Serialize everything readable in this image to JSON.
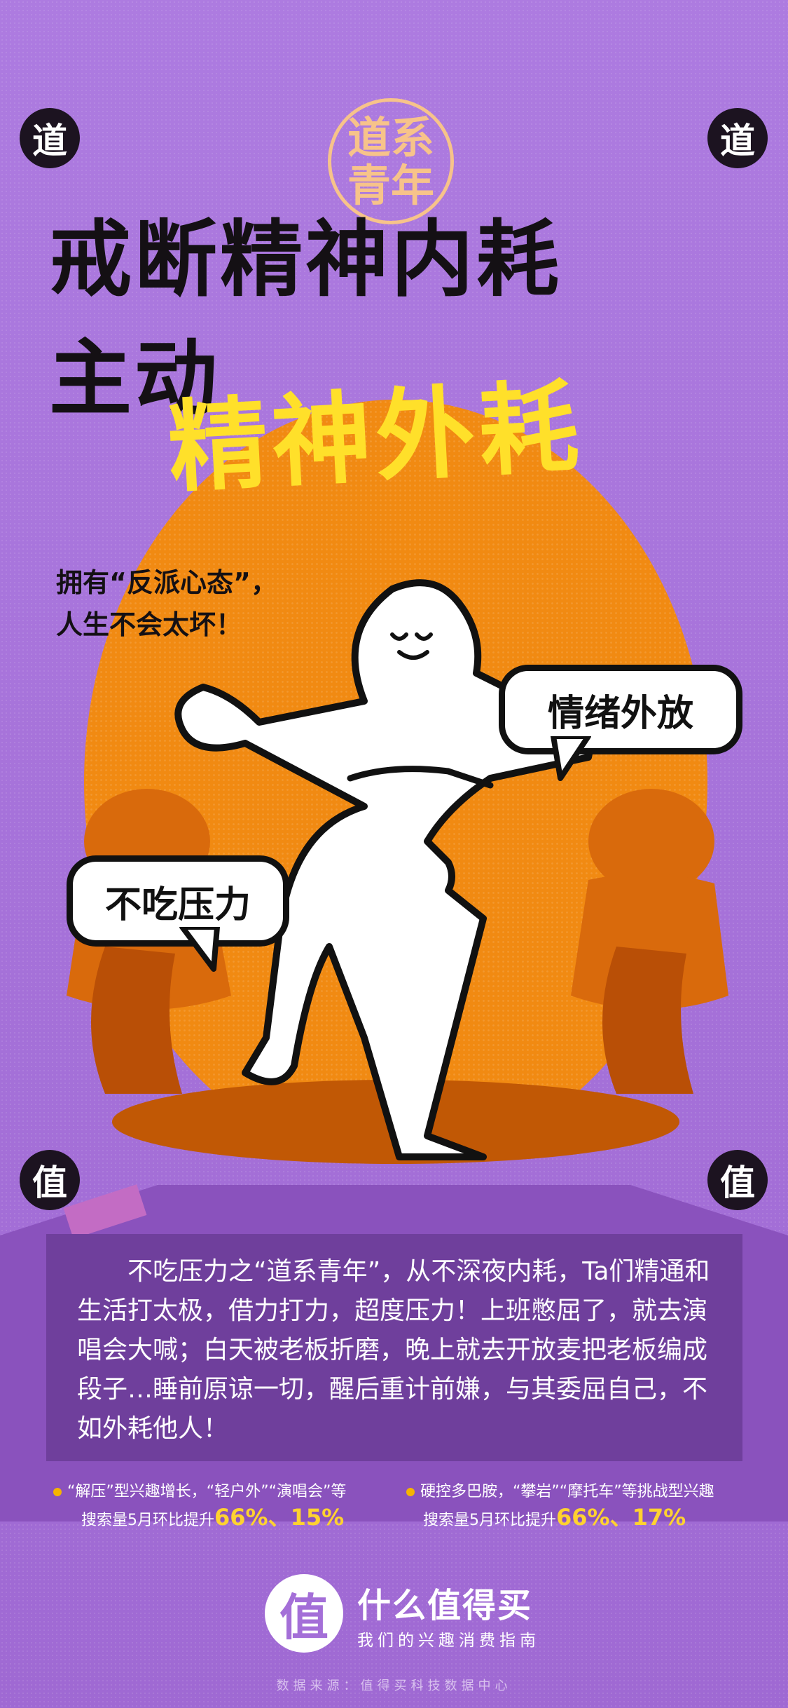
{
  "corners": {
    "top_left": "道",
    "top_right": "道",
    "bottom_left": "值",
    "bottom_right": "值"
  },
  "stamp": {
    "line1": "道系",
    "line2": "青年"
  },
  "title": {
    "line1": "戒断精神内耗",
    "line2": "主动",
    "highlight": "精神外耗"
  },
  "subtitle": {
    "line1": "拥有“反派心态”，",
    "line2": "人生不会太坏！"
  },
  "bubbles": {
    "right": "情绪外放",
    "left": "不吃压力"
  },
  "body_text": "不吃压力之“道系青年”，从不深夜内耗，Ta们精通和生活打太极，借力打力，超度压力！上班憋屈了，就去演唱会大喊；白天被老板折磨，晚上就去开放麦把老板编成段子…睡前原谅一切，醒后重计前嫌，与其委屈自己，不如外耗他人！",
  "stats": [
    {
      "line1": "“解压”型兴趣增长，“轻户外”“演唱会”等",
      "line2_prefix": "搜索量5月环比提升",
      "highlight": "66%、15%"
    },
    {
      "line1": "硬控多巴胺，“攀岩”“摩托车”等挑战型兴趣",
      "line2_prefix": "搜索量5月环比提升",
      "highlight": "66%、17%"
    }
  ],
  "brand": {
    "logo_char": "值",
    "name": "什么值得买",
    "slogan": "我们的兴趣消费指南"
  },
  "source": "数据来源：值得买科技数据中心",
  "colors": {
    "background": "#a46fd8",
    "title": "#141014",
    "highlight": "#ffe02a",
    "sun": "#f18a12",
    "panel": "#6f3f9c",
    "stamp": "#f7c38a"
  }
}
